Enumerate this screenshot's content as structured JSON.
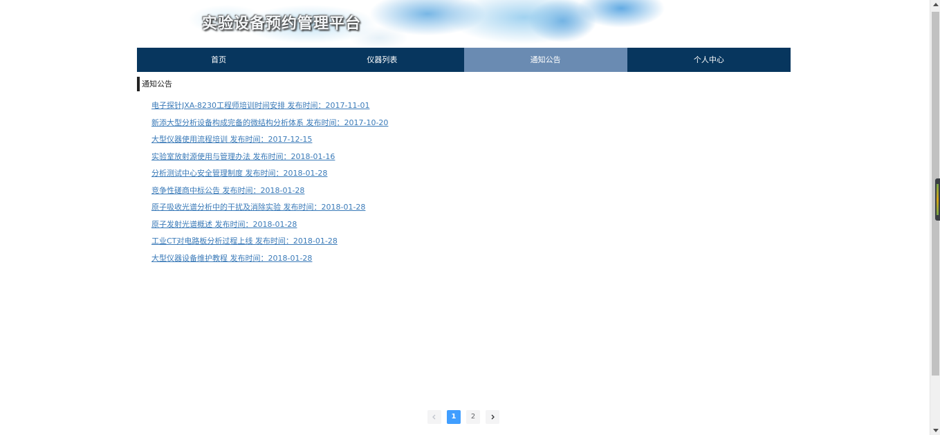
{
  "header": {
    "site_title": "实验设备预约管理平台"
  },
  "nav": {
    "items": [
      {
        "label": "首页",
        "active": false
      },
      {
        "label": "仪器列表",
        "active": false
      },
      {
        "label": "通知公告",
        "active": true
      },
      {
        "label": "个人中心",
        "active": false
      }
    ]
  },
  "section": {
    "title": "通知公告"
  },
  "notices": [
    {
      "text": "电子探针JXA-8230工程师培训时间安排 发布时间：2017-11-01"
    },
    {
      "text": "新添大型分析设备构成完备的微结构分析体系 发布时间：2017-10-20"
    },
    {
      "text": "大型仪器使用流程培训 发布时间：2017-12-15"
    },
    {
      "text": "实验室放射源使用与管理办法 发布时间：2018-01-16"
    },
    {
      "text": "分析测试中心安全管理制度 发布时间：2018-01-28"
    },
    {
      "text": "竞争性磋商中标公告 发布时间：2018-01-28"
    },
    {
      "text": "原子吸收光谱分析中的干扰及消除实验 发布时间：2018-01-28"
    },
    {
      "text": "原子发射光谱概述 发布时间：2018-01-28"
    },
    {
      "text": "工业CT对电路板分析过程上线 发布时间：2018-01-28"
    },
    {
      "text": "大型仪器设备维护教程 发布时间：2018-01-28"
    }
  ],
  "pagination": {
    "prev_icon": "chevron-left-icon",
    "next_icon": "chevron-right-icon",
    "pages": [
      "1",
      "2"
    ],
    "current": "1"
  },
  "colors": {
    "nav_bg": "#07365e",
    "nav_active_bg": "#6a8bb2",
    "link": "#3a7ab8",
    "pager_active": "#409eff"
  }
}
